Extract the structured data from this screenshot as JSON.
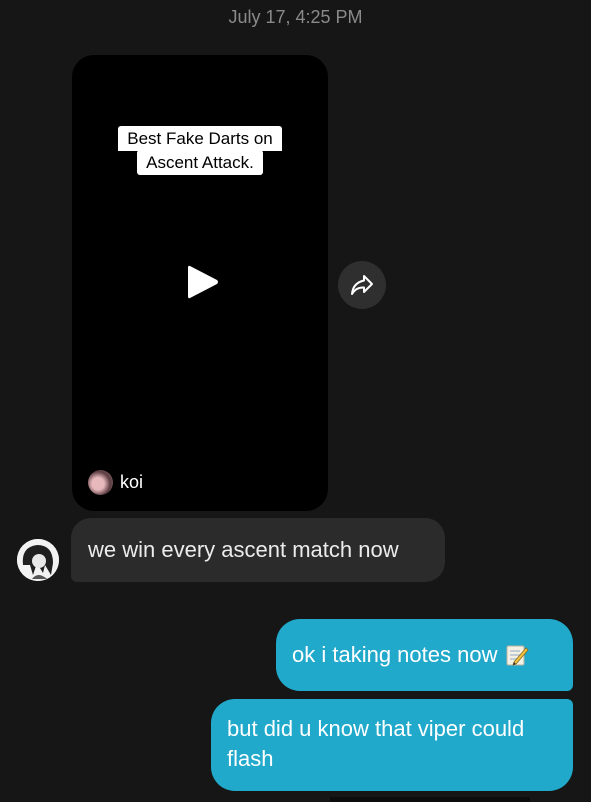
{
  "header": {
    "timestamp": "July 17, 4:25 PM"
  },
  "video": {
    "caption_line1": "Best Fake Darts on",
    "caption_line2": "Ascent Attack.",
    "author": "koi",
    "play_icon": "play-icon",
    "share_icon": "share-arrow-icon"
  },
  "messages": [
    {
      "from": "other",
      "text": "we win every ascent match now"
    },
    {
      "from": "me",
      "text": "ok i taking notes now",
      "emoji": "memo-icon"
    },
    {
      "from": "me",
      "text": "but did u know that viper could flash"
    }
  ],
  "colors": {
    "background": "#161616",
    "received_bubble": "#2b2b2b",
    "sent_bubble": "#21a9cb",
    "timestamp": "#8a8a8a"
  }
}
